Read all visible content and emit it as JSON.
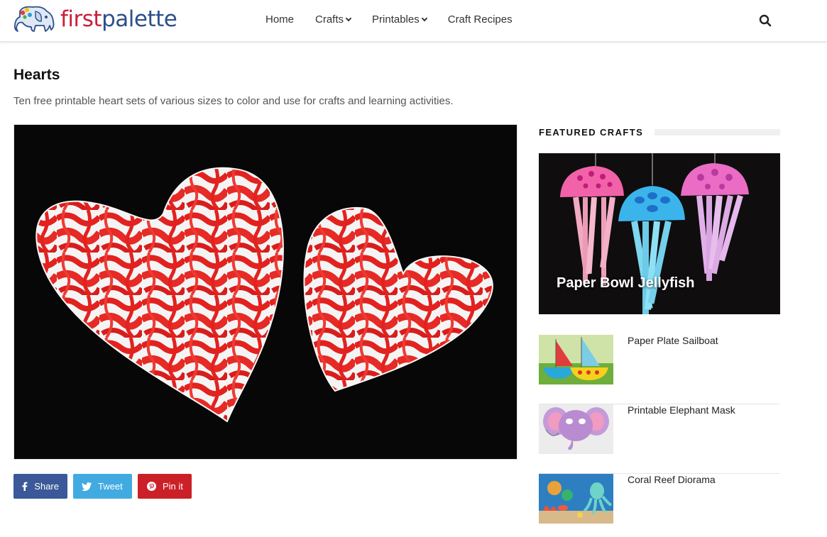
{
  "header": {
    "logo_first": "first",
    "logo_palette": "palette",
    "nav": [
      {
        "label": "Home",
        "dropdown": false
      },
      {
        "label": "Crafts",
        "dropdown": true
      },
      {
        "label": "Printables",
        "dropdown": true
      },
      {
        "label": "Craft Recipes",
        "dropdown": false
      }
    ],
    "search_icon": "search-icon"
  },
  "main": {
    "title": "Hearts",
    "description": "Ten free printable heart sets of various sizes to color and use for crafts and learning activities.",
    "share": {
      "facebook_label": "Share",
      "twitter_label": "Tweet",
      "pinterest_label": "Pin it"
    }
  },
  "sidebar": {
    "heading": "FEATURED CRAFTS",
    "featured_title": "Paper Bowl Jellyfish",
    "items": [
      {
        "title": "Paper Plate Sailboat"
      },
      {
        "title": "Printable Elephant Mask"
      },
      {
        "title": "Coral Reef Diorama"
      }
    ]
  },
  "colors": {
    "brand_red": "#c8203a",
    "brand_blue": "#2d4f8a",
    "facebook": "#3b5998",
    "twitter": "#41abe1",
    "pinterest": "#cb2027"
  }
}
